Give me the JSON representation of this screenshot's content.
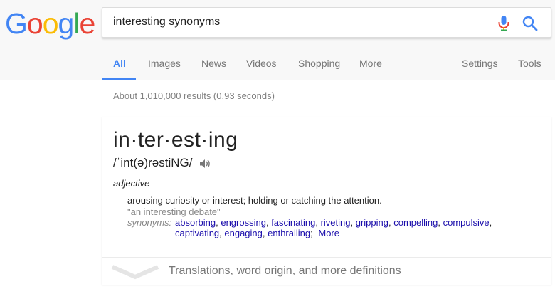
{
  "logo": {
    "letters": [
      "G",
      "o",
      "o",
      "g",
      "l",
      "e"
    ],
    "colors": [
      "#4285f4",
      "#ea4335",
      "#fbbc05",
      "#4285f4",
      "#34a853",
      "#ea4335"
    ]
  },
  "search": {
    "query": "interesting synonyms"
  },
  "tabs": {
    "all": "All",
    "images": "Images",
    "news": "News",
    "videos": "Videos",
    "shopping": "Shopping",
    "more": "More",
    "settings": "Settings",
    "tools": "Tools"
  },
  "stats": "About 1,010,000 results (0.93 seconds)",
  "dictionary": {
    "word": "in·ter·est·ing",
    "phonetic": "/ˈint(ə)rəstiNG/",
    "part_of_speech": "adjective",
    "definition": "arousing curiosity or interest; holding or catching the attention.",
    "example": "\"an interesting debate\"",
    "synonyms_label": "synonyms:",
    "synonyms": [
      "absorbing",
      "engrossing",
      "fascinating",
      "riveting",
      "gripping",
      "compelling",
      "compulsive",
      "captivating",
      "engaging",
      "enthralling"
    ],
    "more": "More",
    "footer_text": "Translations, word origin, and more definitions"
  },
  "colors": {
    "accent": "#4285f4",
    "link": "#1a0dab",
    "muted": "#777777"
  }
}
